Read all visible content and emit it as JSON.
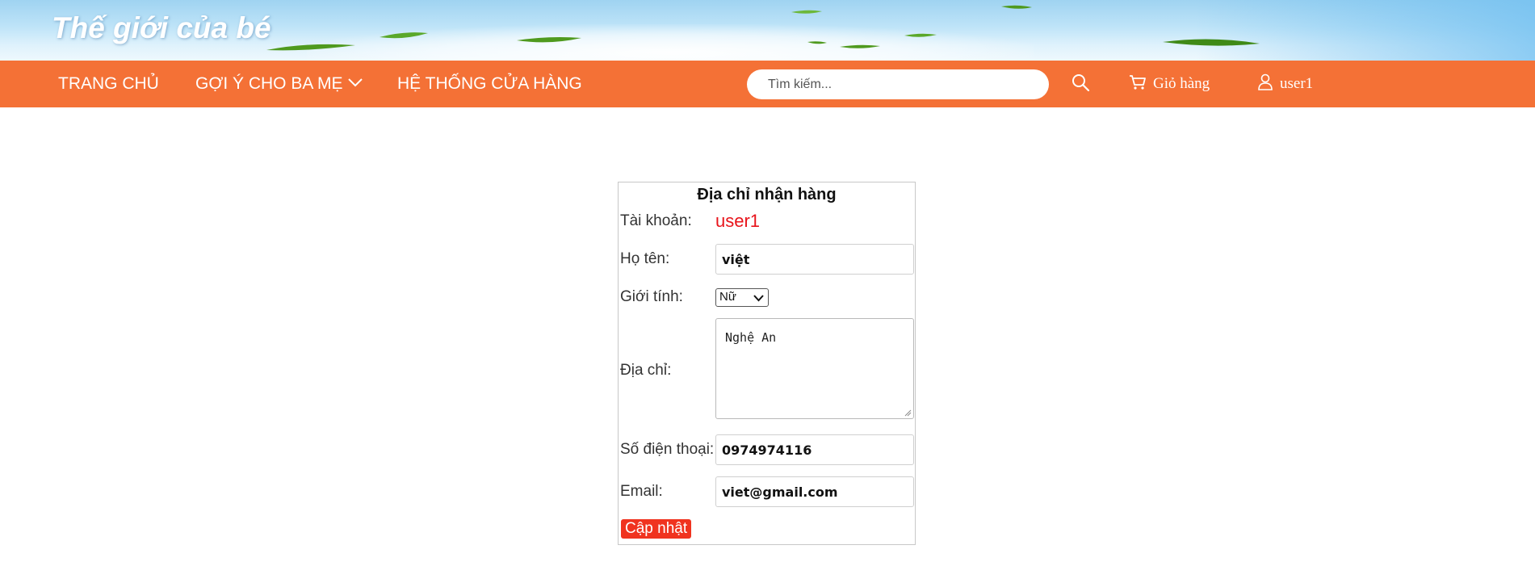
{
  "header": {
    "site_title": "Thế giới của bé"
  },
  "nav": {
    "home": "TRANG CHỦ",
    "suggestions": "GỢI Ý CHO BA MẸ",
    "stores": "HỆ THỐNG CỬA HÀNG",
    "search_placeholder": "Tìm kiếm...",
    "cart": "Giỏ hàng",
    "user": "user1"
  },
  "form": {
    "title": "Địa chỉ nhận hàng",
    "account_label": "Tài khoản:",
    "account_value": "user1",
    "name_label": "Họ tên:",
    "name_value": "việt",
    "gender_label": "Giới tính:",
    "gender_value": "Nữ",
    "address_label": "Địa chỉ:",
    "address_value": "Nghệ An",
    "phone_label": "Số điện thoại:",
    "phone_value": "0974974116",
    "email_label": "Email:",
    "email_value": "viet@gmail.com",
    "submit_label": "Cập nhật"
  },
  "colors": {
    "nav_bar": "#f47136",
    "account_text": "#e8141b",
    "submit_button": "#f0331f"
  }
}
